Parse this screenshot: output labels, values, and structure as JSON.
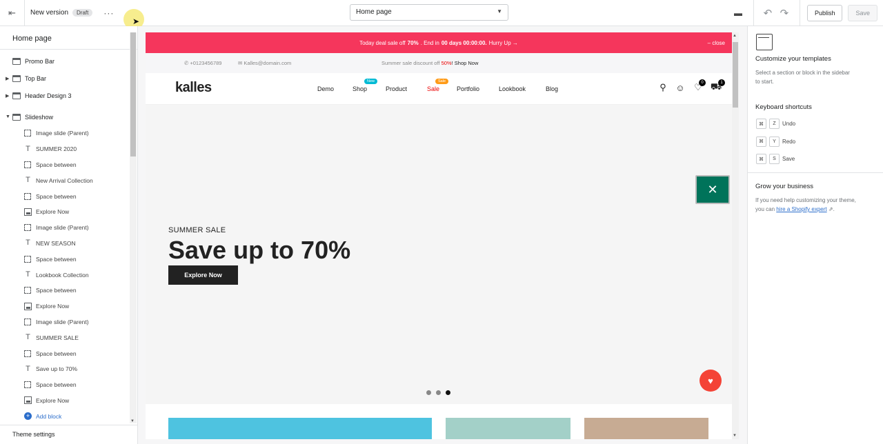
{
  "topbar": {
    "version_label": "New version",
    "draft_badge": "Draft",
    "more_label": "···",
    "page_select": "Home page",
    "publish_label": "Publish",
    "save_label": "Save"
  },
  "left_panel": {
    "title": "Home page",
    "sections": [
      {
        "label": "Promo Bar"
      },
      {
        "label": "Top Bar"
      },
      {
        "label": "Header Design 3"
      },
      {
        "label": "Slideshow"
      }
    ],
    "blocks": [
      {
        "label": "Image slide (Parent)",
        "icon": "dashed-box"
      },
      {
        "label": "SUMMER 2020",
        "icon": "text"
      },
      {
        "label": "Space between",
        "icon": "dashed-box"
      },
      {
        "label": "New Arrival Collection",
        "icon": "text"
      },
      {
        "label": "Space between",
        "icon": "dashed-box"
      },
      {
        "label": "Explore Now",
        "icon": "button"
      },
      {
        "label": "Image slide (Parent)",
        "icon": "dashed-box"
      },
      {
        "label": "NEW SEASON",
        "icon": "text"
      },
      {
        "label": "Space between",
        "icon": "dashed-box"
      },
      {
        "label": "Lookbook Collection",
        "icon": "text"
      },
      {
        "label": "Space between",
        "icon": "dashed-box"
      },
      {
        "label": "Explore Now",
        "icon": "button"
      },
      {
        "label": "Image slide (Parent)",
        "icon": "dashed-box"
      },
      {
        "label": "SUMMER SALE",
        "icon": "text"
      },
      {
        "label": "Space between",
        "icon": "dashed-box"
      },
      {
        "label": "Save up to 70%",
        "icon": "text"
      },
      {
        "label": "Space between",
        "icon": "dashed-box"
      },
      {
        "label": "Explore Now",
        "icon": "button"
      }
    ],
    "add_block": "Add block",
    "theme_settings": "Theme settings"
  },
  "preview": {
    "promo": {
      "text_before": "Today deal sale off",
      "pct": "70%",
      "text_mid": ". End in",
      "countdown": "00 days 00:00:00.",
      "text_after": "Hurry Up →",
      "close": "– close"
    },
    "topbar": {
      "phone": "+0123456789",
      "email": "Kalles@domain.com",
      "summer_text": "Summer sale discount off",
      "summer_pct": "50%",
      "shop_now": "! Shop Now"
    },
    "header": {
      "logo": "kalles",
      "nav": [
        "Demo",
        "Shop",
        "Product",
        "Sale",
        "Portfolio",
        "Lookbook",
        "Blog"
      ],
      "shop_badge": "New",
      "sale_badge": "Sale",
      "wishlist_count": "0",
      "cart_count": "1"
    },
    "hero": {
      "subtitle": "SUMMER SALE",
      "title": "Save up to 70%",
      "button": "Explore Now",
      "active_slide": 3
    },
    "colors": {
      "promo_bg": "#f5365c",
      "fab_tool": "#00735a",
      "fab_heart": "#f44336",
      "banner_1": "#4ec3e0",
      "banner_2": "#a3d0c8",
      "banner_3": "#c7ab93"
    }
  },
  "right_panel": {
    "customize_title": "Customize your templates",
    "customize_desc": "Select a section or block in the sidebar to start.",
    "shortcuts_title": "Keyboard shortcuts",
    "shortcuts": [
      {
        "key": "Z",
        "label": "Undo"
      },
      {
        "key": "Y",
        "label": "Redo"
      },
      {
        "key": "S",
        "label": "Save"
      }
    ],
    "grow_title": "Grow your business",
    "grow_desc": "If you need help customizing your theme, you can",
    "grow_link": "hire a Shopify expert",
    "grow_end": "."
  }
}
